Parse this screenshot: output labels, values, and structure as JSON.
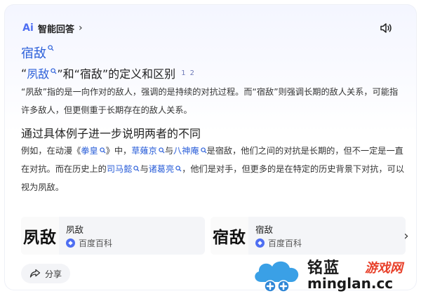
{
  "header": {
    "logo_text": "Ai",
    "title": "智能回答"
  },
  "search_term": "宿敌",
  "section1": {
    "title_prefix": "“",
    "title_link": "夙敌",
    "title_suffix": "”和“宿敌”的定义和区别",
    "refs": [
      "1",
      "2"
    ],
    "paragraph": "“夙敌”指的是一向作对的敌人，强调的是持续的对抗过程。而“宿敌”则强调长期的敌人关系，可能指许多敌人，但更侧重于长期存在的敌人关系。"
  },
  "section2": {
    "title": "通过具体例子进一步说明两者的不同",
    "p_1": "例如，在动漫《",
    "l_1": "拳皇",
    "p_2": "》中，",
    "l_2": "草薙京",
    "p_3": "与",
    "l_3": "八神庵",
    "p_4": "是宿敌，他们之间的对抗是长期的，但不一定是一直在对抗。而在历史上的",
    "l_4": "司马懿",
    "p_5": "与",
    "l_5": "诸葛亮",
    "p_6": "，他们是对手，但更多的是在特定的历史背景下对抗，可以视为夙敌。"
  },
  "cards": [
    {
      "image_text": "夙敌",
      "title": "夙敌",
      "source": "百度百科"
    },
    {
      "image_text": "宿敌",
      "title": "宿敌",
      "source": "百度百科"
    }
  ],
  "share_label": "分享",
  "watermark": {
    "cn": "铭蓝",
    "cn2": "游戏网",
    "en": "minglan.cc"
  },
  "colors": {
    "link": "#2b5fd9",
    "accent": "#4e6ef2",
    "watermark_red": "#e8402a"
  }
}
